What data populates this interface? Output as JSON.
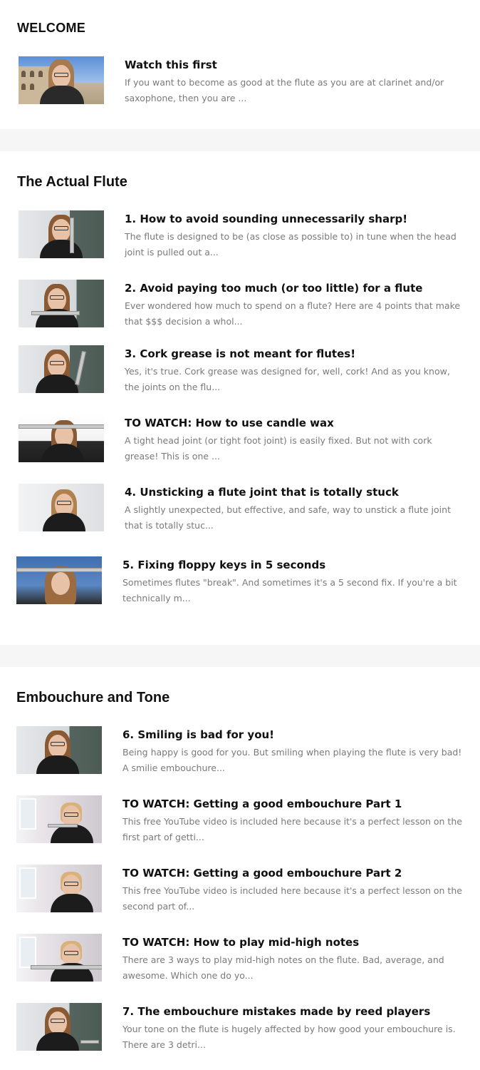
{
  "sections": [
    {
      "title": "WELCOME",
      "lessons": [
        {
          "title": "Watch this first",
          "desc": "If you want to become as good at the flute as you are at clarinet and/or saxophone, then you are ..."
        }
      ]
    },
    {
      "title": "The Actual Flute",
      "lessons": [
        {
          "title": "1. How to avoid sounding unnecessarily sharp!",
          "desc": "The flute is designed to be (as close as possible to) in tune when the head joint is pulled out a..."
        },
        {
          "title": "2. Avoid paying too much (or too little) for a flute",
          "desc": "Ever wondered how much to spend on a flute? Here are 4 points that make that $$$ decision a whol..."
        },
        {
          "title": "3. Cork grease is not meant for flutes!",
          "desc": "Yes, it's true. Cork grease was designed for, well, cork! And as you know, the joints on the flu..."
        },
        {
          "title": "TO WATCH: How to use candle wax",
          "desc": "A tight head joint (or tight foot joint) is easily fixed. But not with cork grease! This is one ..."
        },
        {
          "title": "4. Unsticking a flute joint that is totally stuck",
          "desc": "A slightly unexpected, but effective, and safe, way to unstick a flute joint that is totally stuc..."
        },
        {
          "title": "5. Fixing floppy keys in 5 seconds",
          "desc": "Sometimes flutes \"break\". And sometimes it's a 5 second fix. If you're a bit technically m..."
        }
      ]
    },
    {
      "title": "Embouchure and Tone",
      "lessons": [
        {
          "title": "6. Smiling is bad for you!",
          "desc": "Being happy is good for you. But smiling when playing the flute is very bad! A smilie embouchure..."
        },
        {
          "title": "TO WATCH: Getting a good embouchure Part 1",
          "desc": "This free YouTube video is included here because it's a perfect lesson on the first part of getti..."
        },
        {
          "title": "TO WATCH: Getting a good embouchure Part 2",
          "desc": "This free YouTube video is included here because it's a perfect lesson on the second part of..."
        },
        {
          "title": "TO WATCH: How to play mid-high notes",
          "desc": "There are 3 ways to play mid-high notes on the flute. Bad, average, and awesome. Which one do yo..."
        },
        {
          "title": "7. The embouchure mistakes made by reed players",
          "desc": "Your tone on the flute is hugely affected by how good your embouchure is. There are 3 detri..."
        }
      ]
    }
  ],
  "colors": {
    "title": "#111111",
    "desc": "#7a7a7a",
    "divider": "#f6f6f6"
  }
}
